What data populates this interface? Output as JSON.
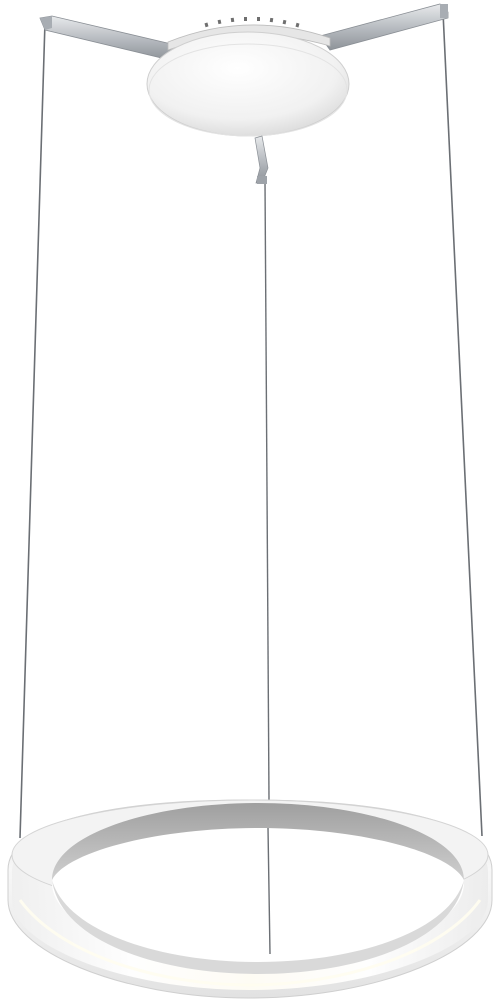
{
  "image": {
    "subject": "pendant-light",
    "background_color": "#ffffff",
    "colors": {
      "canopy": "#f2f2f2",
      "canopy_shade": "#d9d9d9",
      "arm": "#c9ccd0",
      "arm_dark": "#8e9399",
      "cable": "#6b6f74",
      "ring_outer": "#e9e9e9",
      "ring_inner": "#b8b8b8",
      "ring_glow": "#fffdf6"
    }
  }
}
